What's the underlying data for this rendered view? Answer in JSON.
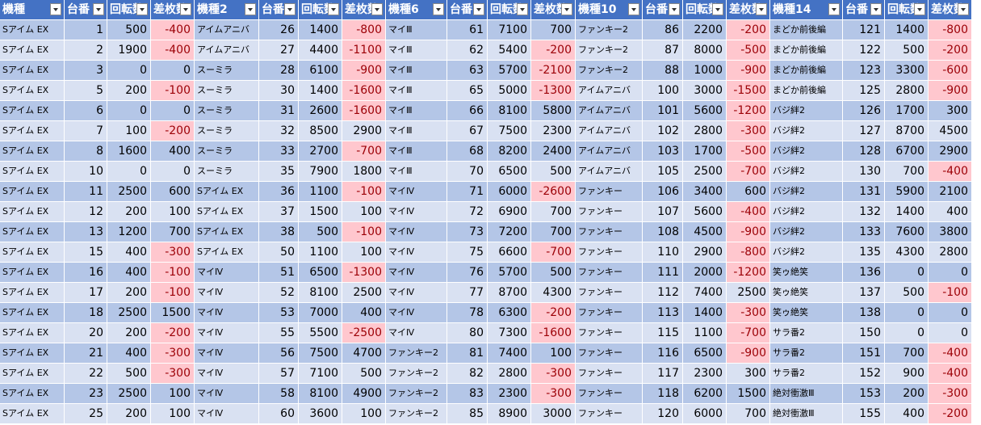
{
  "headers": [
    "機種",
    "台番",
    "回転数",
    "差枚数",
    "機種2",
    "台番",
    "回転数",
    "差枚数",
    "機種6",
    "台番",
    "回転数",
    "差枚数",
    "機種10",
    "台番",
    "回転数",
    "差枚数",
    "機種14",
    "台番",
    "回転数",
    "差枚数"
  ],
  "rows": [
    [
      "Sアイム EX",
      "1",
      "500",
      "-400",
      "アイムアニバ",
      "26",
      "1400",
      "-800",
      "マイⅢ",
      "61",
      "7100",
      "700",
      "ファンキー2",
      "86",
      "2200",
      "-200",
      "まどか前後編",
      "121",
      "1400",
      "-800"
    ],
    [
      "Sアイム EX",
      "2",
      "1900",
      "-400",
      "アイムアニバ",
      "27",
      "4400",
      "-1100",
      "マイⅢ",
      "62",
      "5400",
      "-200",
      "ファンキー2",
      "87",
      "8000",
      "-500",
      "まどか前後編",
      "122",
      "500",
      "-200"
    ],
    [
      "Sアイム EX",
      "3",
      "0",
      "0",
      "スーミラ",
      "28",
      "6100",
      "-900",
      "マイⅢ",
      "63",
      "5700",
      "-2100",
      "ファンキー2",
      "88",
      "1000",
      "-900",
      "まどか前後編",
      "123",
      "3300",
      "-600"
    ],
    [
      "Sアイム EX",
      "5",
      "200",
      "-100",
      "スーミラ",
      "30",
      "1400",
      "-1600",
      "マイⅢ",
      "65",
      "5000",
      "-1300",
      "アイムアニバ",
      "100",
      "3000",
      "-1500",
      "まどか前後編",
      "125",
      "2800",
      "-900"
    ],
    [
      "Sアイム EX",
      "6",
      "0",
      "0",
      "スーミラ",
      "31",
      "2600",
      "-1600",
      "マイⅢ",
      "66",
      "8100",
      "5800",
      "アイムアニバ",
      "101",
      "5600",
      "-1200",
      "バジ絆2",
      "126",
      "1700",
      "300"
    ],
    [
      "Sアイム EX",
      "7",
      "100",
      "-200",
      "スーミラ",
      "32",
      "8500",
      "2900",
      "マイⅢ",
      "67",
      "7500",
      "2300",
      "アイムアニバ",
      "102",
      "2800",
      "-300",
      "バジ絆2",
      "127",
      "8700",
      "4500"
    ],
    [
      "Sアイム EX",
      "8",
      "1600",
      "400",
      "スーミラ",
      "33",
      "2700",
      "-700",
      "マイⅢ",
      "68",
      "8200",
      "2400",
      "アイムアニバ",
      "103",
      "1700",
      "-500",
      "バジ絆2",
      "128",
      "6700",
      "2900"
    ],
    [
      "Sアイム EX",
      "10",
      "0",
      "0",
      "スーミラ",
      "35",
      "7900",
      "1800",
      "マイⅢ",
      "70",
      "6500",
      "500",
      "アイムアニバ",
      "105",
      "2500",
      "-700",
      "バジ絆2",
      "130",
      "700",
      "-400"
    ],
    [
      "Sアイム EX",
      "11",
      "2500",
      "600",
      "Sアイム EX",
      "36",
      "1100",
      "-100",
      "マイⅣ",
      "71",
      "6000",
      "-2600",
      "ファンキー",
      "106",
      "3400",
      "600",
      "バジ絆2",
      "131",
      "5900",
      "2100"
    ],
    [
      "Sアイム EX",
      "12",
      "200",
      "100",
      "Sアイム EX",
      "37",
      "1500",
      "100",
      "マイⅣ",
      "72",
      "6900",
      "700",
      "ファンキー",
      "107",
      "5600",
      "-400",
      "バジ絆2",
      "132",
      "1400",
      "400"
    ],
    [
      "Sアイム EX",
      "13",
      "1200",
      "700",
      "Sアイム EX",
      "38",
      "500",
      "-100",
      "マイⅣ",
      "73",
      "7200",
      "700",
      "ファンキー",
      "108",
      "4500",
      "-900",
      "バジ絆2",
      "133",
      "7600",
      "3800"
    ],
    [
      "Sアイム EX",
      "15",
      "400",
      "-300",
      "Sアイム EX",
      "50",
      "1100",
      "100",
      "マイⅣ",
      "75",
      "6600",
      "-700",
      "ファンキー",
      "110",
      "2900",
      "-800",
      "バジ絆2",
      "135",
      "4300",
      "2800"
    ],
    [
      "Sアイム EX",
      "16",
      "400",
      "-100",
      "マイⅣ",
      "51",
      "6500",
      "-1300",
      "マイⅣ",
      "76",
      "5700",
      "500",
      "ファンキー",
      "111",
      "2000",
      "-1200",
      "笑ゥ絶笑",
      "136",
      "0",
      "0"
    ],
    [
      "Sアイム EX",
      "17",
      "200",
      "-100",
      "マイⅣ",
      "52",
      "8100",
      "2500",
      "マイⅣ",
      "77",
      "8700",
      "4300",
      "ファンキー",
      "112",
      "7400",
      "2500",
      "笑ゥ絶笑",
      "137",
      "500",
      "-100"
    ],
    [
      "Sアイム EX",
      "18",
      "2500",
      "1500",
      "マイⅣ",
      "53",
      "7000",
      "400",
      "マイⅣ",
      "78",
      "6300",
      "-200",
      "ファンキー",
      "113",
      "1400",
      "-300",
      "笑ゥ絶笑",
      "138",
      "0",
      "0"
    ],
    [
      "Sアイム EX",
      "20",
      "200",
      "-200",
      "マイⅣ",
      "55",
      "5500",
      "-2500",
      "マイⅣ",
      "80",
      "7300",
      "-1600",
      "ファンキー",
      "115",
      "1100",
      "-700",
      "サラ番2",
      "150",
      "0",
      "0"
    ],
    [
      "Sアイム EX",
      "21",
      "400",
      "-300",
      "マイⅣ",
      "56",
      "7500",
      "4700",
      "ファンキー2",
      "81",
      "7400",
      "100",
      "ファンキー",
      "116",
      "6500",
      "-900",
      "サラ番2",
      "151",
      "700",
      "-400"
    ],
    [
      "Sアイム EX",
      "22",
      "500",
      "-300",
      "マイⅣ",
      "57",
      "7100",
      "500",
      "ファンキー2",
      "82",
      "2800",
      "-300",
      "ファンキー",
      "117",
      "2300",
      "300",
      "サラ番2",
      "152",
      "900",
      "-400"
    ],
    [
      "Sアイム EX",
      "23",
      "2500",
      "100",
      "マイⅣ",
      "58",
      "8100",
      "4900",
      "ファンキー2",
      "83",
      "2300",
      "-300",
      "ファンキー",
      "118",
      "6200",
      "1500",
      "絶対衝激Ⅲ",
      "153",
      "200",
      "-300"
    ],
    [
      "Sアイム EX",
      "25",
      "200",
      "100",
      "マイⅣ",
      "60",
      "3600",
      "100",
      "ファンキー2",
      "85",
      "8900",
      "3000",
      "ファンキー",
      "120",
      "6000",
      "700",
      "絶対衝激Ⅲ",
      "155",
      "400",
      "-200"
    ]
  ],
  "style": {
    "header_bg": "#4472c4",
    "band_dark": "#b4c6e7",
    "band_light": "#d9e1f2",
    "negative_fill": "#ffc7ce",
    "negative_text": "#9c0006"
  },
  "icons": {
    "filter_button": "filter-dropdown-icon"
  }
}
